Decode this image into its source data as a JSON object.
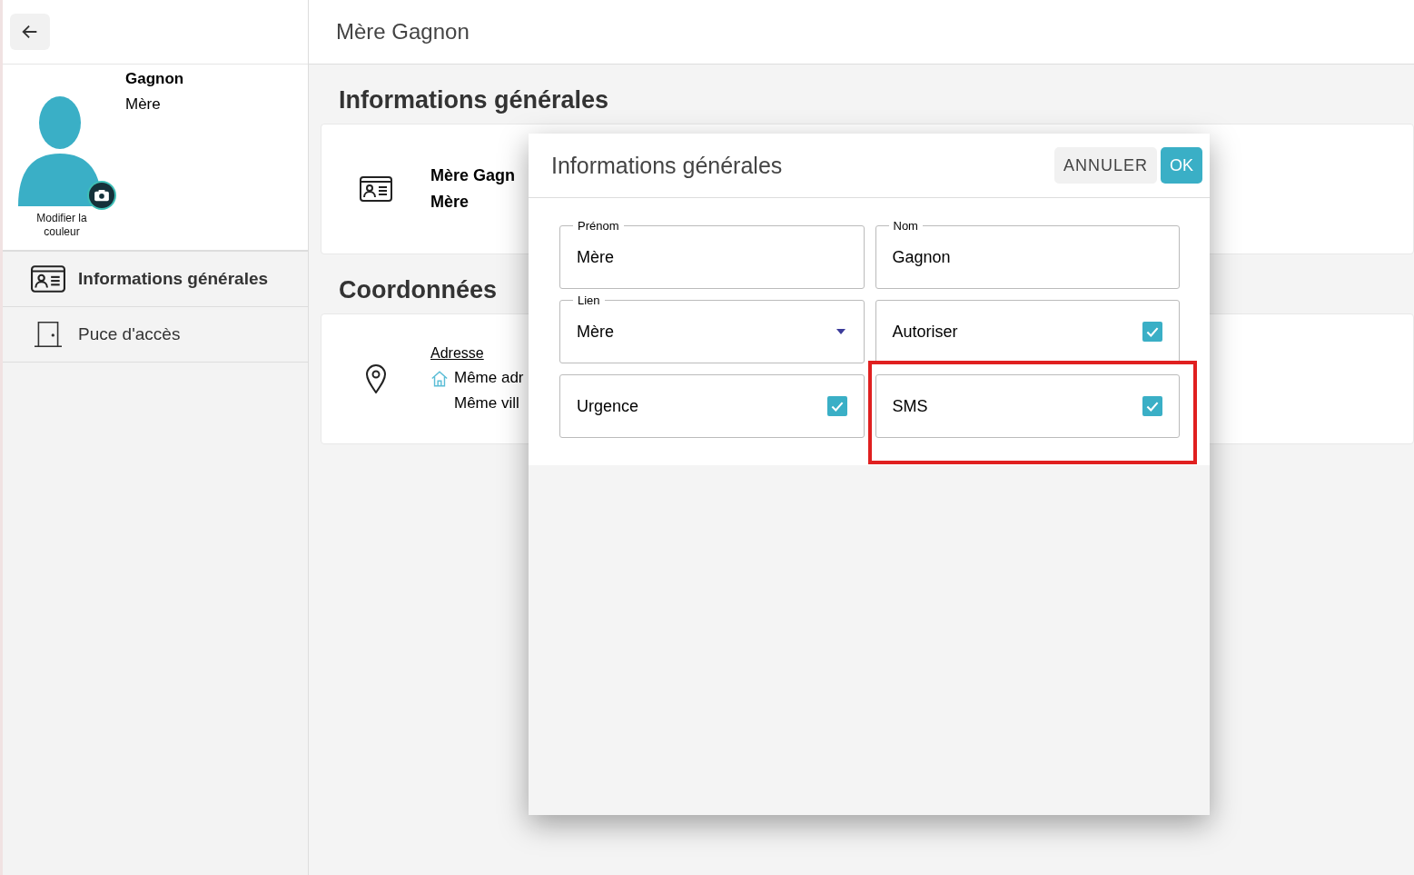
{
  "profile": {
    "last_name": "Gagnon",
    "relation": "Mère",
    "color_link": "Modifier la couleur"
  },
  "nav": [
    {
      "label": "Informations générales",
      "selected": true
    },
    {
      "label": "Puce d'accès",
      "selected": false
    }
  ],
  "header": {
    "title": "Mère Gagnon"
  },
  "sections": [
    {
      "title": "Informations générales",
      "lines": [
        {
          "text": "Mère Gagn",
          "kind": "bold"
        },
        {
          "text": "Mère",
          "kind": "bold"
        }
      ]
    },
    {
      "title": "Coordonnées",
      "lines": [
        {
          "text": "Adresse",
          "kind": "link"
        },
        {
          "text": "Même adr",
          "kind": "home"
        },
        {
          "text": "Même vill",
          "kind": "plain"
        }
      ]
    }
  ],
  "dialog": {
    "title": "Informations générales",
    "cancel": "ANNULER",
    "ok": "OK",
    "fields": [
      {
        "kind": "text",
        "label": "Prénom",
        "value": "Mère",
        "highlighted": false
      },
      {
        "kind": "text",
        "label": "Nom",
        "value": "Gagnon",
        "highlighted": false
      },
      {
        "kind": "select",
        "label": "Lien",
        "value": "Mère",
        "highlighted": false
      },
      {
        "kind": "checkbox",
        "value": "Autoriser",
        "checked": true,
        "highlighted": false
      },
      {
        "kind": "checkbox",
        "value": "Urgence",
        "checked": true,
        "highlighted": false
      },
      {
        "kind": "checkbox",
        "value": "SMS",
        "checked": true,
        "highlighted": true
      }
    ]
  }
}
